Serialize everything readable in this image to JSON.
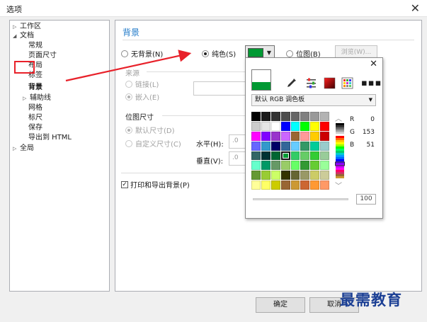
{
  "window": {
    "title": "选项",
    "close_glyph": "✕"
  },
  "tree": {
    "items": [
      {
        "label": "工作区",
        "arrow": "▷",
        "level": 0
      },
      {
        "label": "文档",
        "arrow": "◢",
        "level": 0
      },
      {
        "label": "常规",
        "arrow": "",
        "level": 1
      },
      {
        "label": "页面尺寸",
        "arrow": "",
        "level": 1
      },
      {
        "label": "布局",
        "arrow": "",
        "level": 1
      },
      {
        "label": "标签",
        "arrow": "",
        "level": 1
      },
      {
        "label": "背景",
        "arrow": "",
        "level": 1,
        "selected": true
      },
      {
        "label": "辅助线",
        "arrow": "▷",
        "level": 1
      },
      {
        "label": "网格",
        "arrow": "",
        "level": 1
      },
      {
        "label": "标尺",
        "arrow": "",
        "level": 1
      },
      {
        "label": "保存",
        "arrow": "",
        "level": 1
      },
      {
        "label": "导出到 HTML",
        "arrow": "",
        "level": 1
      },
      {
        "label": "全局",
        "arrow": "▷",
        "level": 0
      }
    ]
  },
  "background": {
    "heading": "背景",
    "options": {
      "none": "无背景(N)",
      "solid": "纯色(S)",
      "bitmap": "位图(B)",
      "selected": "solid"
    },
    "solid_color": "#009933",
    "browse_label": "浏览(W)..."
  },
  "source": {
    "label": "来源",
    "link": "链接(L)",
    "embed": "嵌入(E)"
  },
  "bitmap_size": {
    "label": "位图尺寸",
    "default": "默认尺寸(D)",
    "custom": "自定义尺寸(C)",
    "horizontal_label": "水平(H):",
    "vertical_label": "垂直(V):",
    "horizontal_value": ".0",
    "vertical_value": ".0"
  },
  "print_export": {
    "label": "打印和导出背景(P)",
    "checked": true
  },
  "buttons": {
    "ok": "确定",
    "cancel": "取消"
  },
  "picker": {
    "close_glyph": "✕",
    "palette_name": "默认 RGB 调色板",
    "current_color": "#009933",
    "tools": [
      "eyedropper-icon",
      "mixer-sliders-icon",
      "color-viewer-icon",
      "palette-grid-icon",
      "more-icon"
    ],
    "swatches": [
      "#000000",
      "#1a1a1a",
      "#333333",
      "#4d4d4d",
      "#666666",
      "#808080",
      "#999999",
      "#b3b3b3",
      "#cccccc",
      "#e6e6e6",
      "#ffffff",
      "#0000ff",
      "#00ffff",
      "#00ff00",
      "#ffff00",
      "#ff0000",
      "#ff00ff",
      "#8000ff",
      "#9933cc",
      "#cc66ff",
      "#996633",
      "#ff9999",
      "#ffcc00",
      "#cc0000",
      "#6666ff",
      "#3399cc",
      "#000066",
      "#336699",
      "#66ccff",
      "#339966",
      "#00cc99",
      "#99cccc",
      "#336666",
      "#003333",
      "#006633",
      "#009933",
      "#33cc66",
      "#66cc66",
      "#33cc33",
      "#99cc99",
      "#66ffcc",
      "#009966",
      "#669966",
      "#99cc66",
      "#66ff66",
      "#339933",
      "#66cc33",
      "#99ff99",
      "#669933",
      "#99cc33",
      "#ccff66",
      "#333300",
      "#666633",
      "#999966",
      "#cccc66",
      "#cccc99",
      "#ffff99",
      "#ffff66",
      "#cccc00",
      "#996633",
      "#cc9933",
      "#cc6633",
      "#ff9933",
      "#ff9966"
    ],
    "selected_index": 35,
    "r_label": "R",
    "g_label": "G",
    "b_label": "B",
    "r": "0",
    "g": "153",
    "b": "51",
    "slider_value": "100"
  },
  "watermark": "最需教育"
}
